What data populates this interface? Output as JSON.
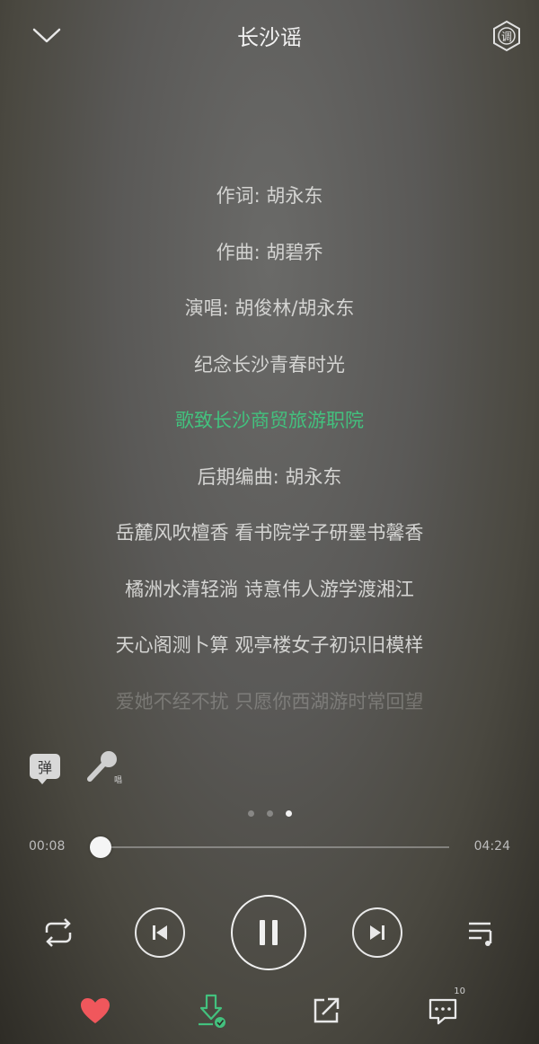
{
  "header": {
    "title": "长沙谣",
    "back_icon": "chevron-down-icon",
    "settings_icon": "settings-hexagon-icon",
    "settings_glyph": "调"
  },
  "lyrics": {
    "lines": [
      "作词: 胡永东",
      "作曲: 胡碧乔",
      "演唱: 胡俊林/胡永东",
      "纪念长沙青春时光",
      "歌致长沙商贸旅游职院",
      "后期编曲: 胡永东",
      "岳麓风吹檀香 看书院学子研墨书馨香",
      "橘洲水清轻淌 诗意伟人游学渡湘江",
      "天心阁测卜算 观亭楼女子初识旧模样",
      "爱她不经不扰 只愿你西湖游时常回望"
    ],
    "active_index": 4,
    "active_color": "#43c17e"
  },
  "tools": {
    "danmu_label": "弹",
    "mic_label": "唱"
  },
  "pager": {
    "count": 3,
    "active": 2
  },
  "progress": {
    "current": "00:08",
    "total": "04:24",
    "fraction": 0.03
  },
  "actions": {
    "comment_count": "10",
    "like_color": "#f0575c",
    "download_color": "#43c17e"
  }
}
